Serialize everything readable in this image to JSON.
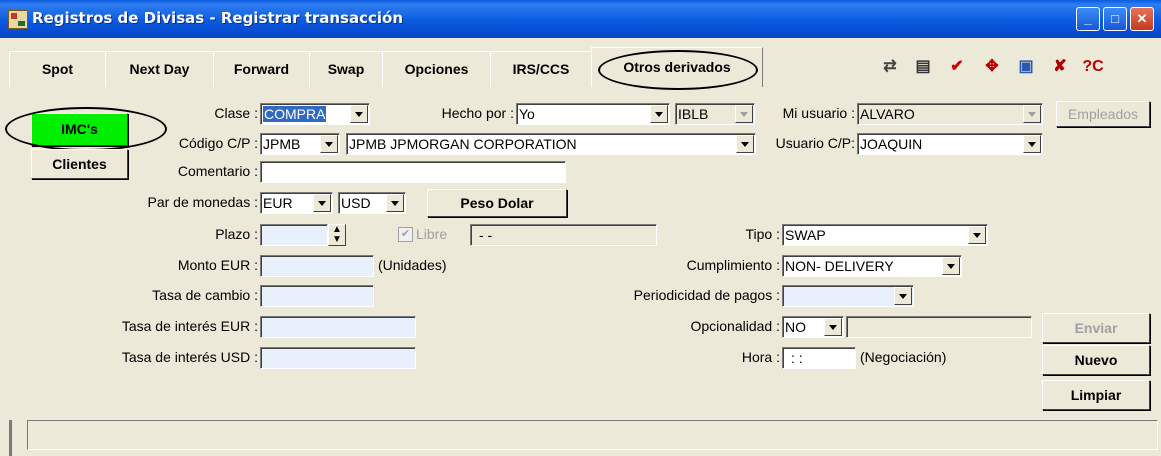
{
  "window": {
    "title": "Registros de Divisas - Registrar transacción"
  },
  "tabs": [
    "Spot",
    "Next Day",
    "Forward",
    "Swap",
    "Opciones",
    "IRS/CCS",
    "Otros derivados"
  ],
  "side_buttons": {
    "imc": "IMC's",
    "clientes": "Clientes"
  },
  "form": {
    "clase_label": "Clase :",
    "clase_value": "COMPRA",
    "hecho_por_label": "Hecho por :",
    "hecho_por_value": "Yo",
    "iblb_value": "IBLB",
    "mi_usuario_label": "Mi usuario :",
    "mi_usuario_value": "ALVARO",
    "empleados_label": "Empleados",
    "codigo_label": "Código C/P :",
    "codigo_value": "JPMB",
    "codigo_name": "JPMB  JPMORGAN CORPORATION",
    "usuario_cp_label": "Usuario C/P:",
    "usuario_cp_value": "JOAQUIN",
    "comentario_label": "Comentario :",
    "comentario_value": "",
    "par_label": "Par de monedas :",
    "par_1": "EUR",
    "par_2": "USD",
    "peso_dolar_label": "Peso Dolar",
    "plazo_label": "Plazo :",
    "libre_label": "Libre",
    "libre_date": "- -",
    "tipo_label": "Tipo :",
    "tipo_value": "SWAP",
    "monto_label": "Monto EUR :",
    "unidades_label": "(Unidades)",
    "cumplimiento_label": "Cumplimiento :",
    "cumplimiento_value": "NON- DELIVERY",
    "tasa_cambio_label": "Tasa de cambio :",
    "periodicidad_label": "Periodicidad de pagos :",
    "tasa_eur_label": "Tasa de interés EUR :",
    "opcionalidad_label": "Opcionalidad :",
    "opcionalidad_value": "NO",
    "tasa_usd_label": "Tasa de interés USD :",
    "hora_label": "Hora :",
    "hora_value": ": :",
    "negociacion_label": "(Negociación)"
  },
  "action_buttons": {
    "enviar": "Enviar",
    "nuevo": "Nuevo",
    "limpiar": "Limpiar"
  },
  "toolbar_icons": [
    "swap-docs-icon",
    "sheet-icon",
    "check-search-icon",
    "move-icon",
    "page-icon",
    "delete-doc-icon",
    "help-icon"
  ],
  "colors": {
    "titlebar": "#0a5ae0",
    "imc_button": "#00ee00",
    "selection": "#316ac5",
    "field_blue": "#e8f0fc"
  }
}
